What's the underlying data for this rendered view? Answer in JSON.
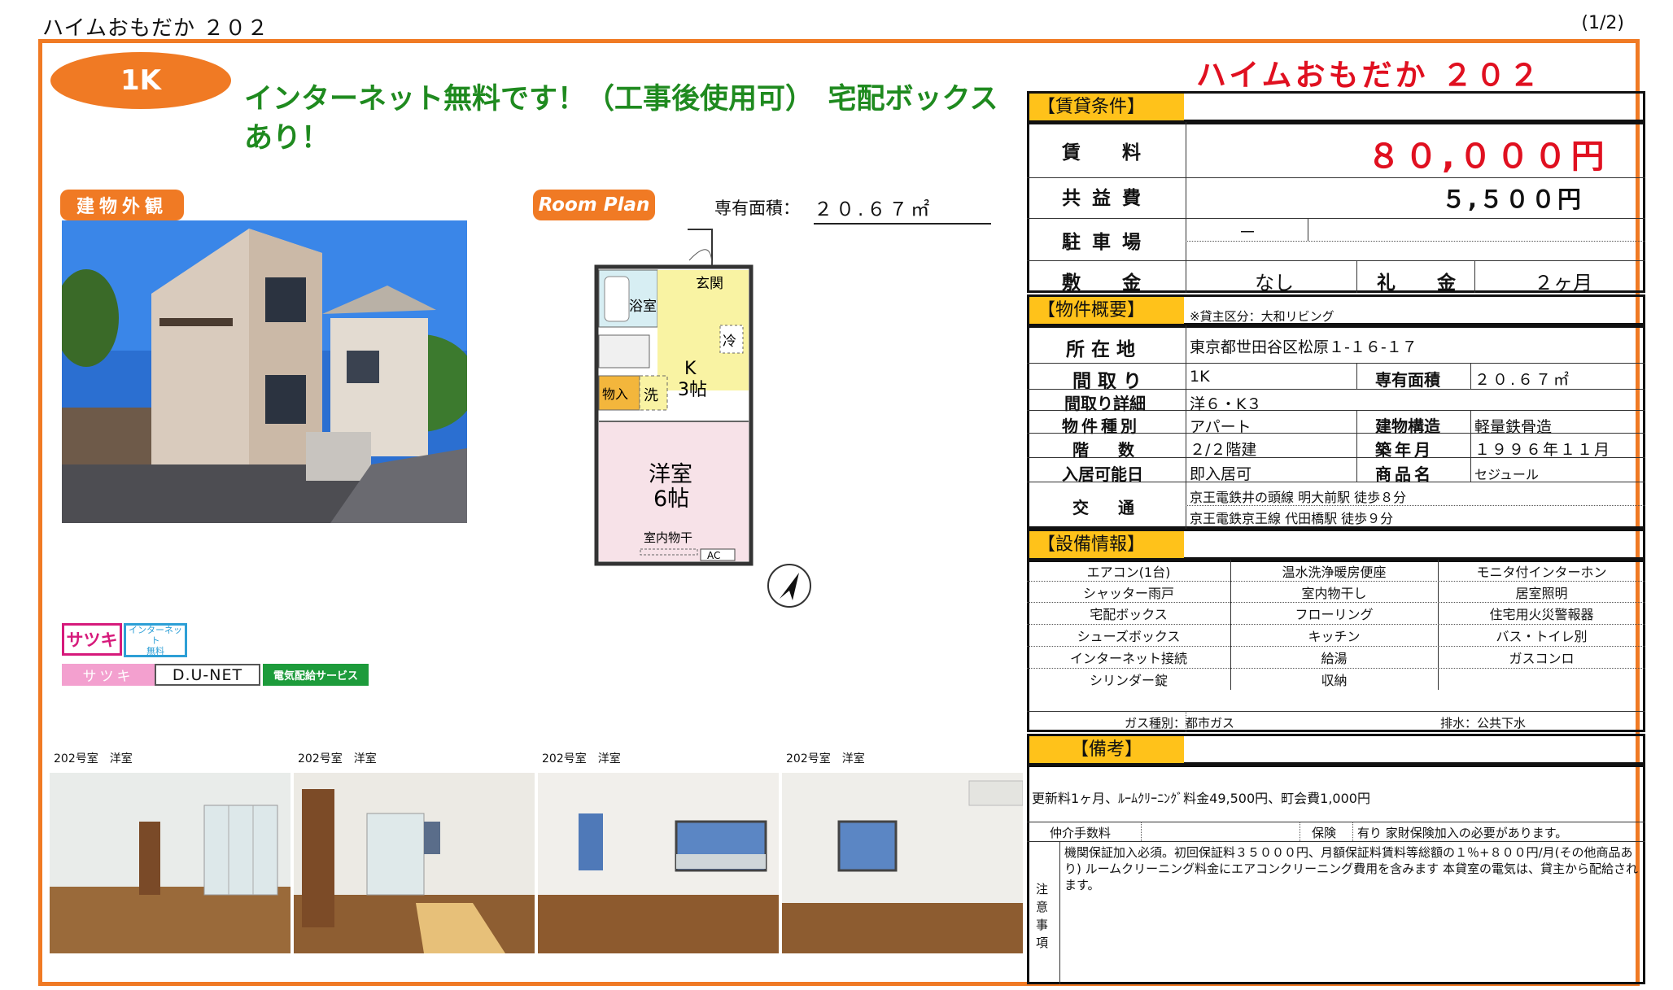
{
  "header": {
    "title": "ハイムおもだか ２０２",
    "page_indicator": "(1/2)"
  },
  "left": {
    "layout_badge": "1K",
    "catchphrase": "インターネット無料です！（工事後使用可）　宅配ボックスあり！",
    "exterior_tag": "建物外観",
    "plan_tag": "Room Plan",
    "area_label": "専有面積：",
    "area_value": "２０.６７㎡",
    "floor_plan": {
      "bath": "浴室",
      "entrance": "玄関",
      "kitchen": "K\n3帖",
      "kitchen_k": "K",
      "kitchen_size": "3帖",
      "storage": "物入",
      "washer": "洗",
      "fridge": "冷",
      "western": "洋室",
      "western_size": "6帖",
      "dry": "室内物干",
      "ac": "AC"
    },
    "logos": {
      "satsuki": "サツキ",
      "internet_free": "インターネット\n無料",
      "internet_free_1": "インターネット",
      "internet_free_2": "無料",
      "satsuki_band": "サツキ",
      "dunet": "D.U-NET",
      "power": "電気配給サービス"
    },
    "room_photos": [
      {
        "label": "202号室　洋室"
      },
      {
        "label": "202号室　洋室"
      },
      {
        "label": "202号室　洋室"
      },
      {
        "label": "202号室　洋室"
      }
    ]
  },
  "right": {
    "property_title": "ハイムおもだか ２０２",
    "rent_section": "【賃貸条件】",
    "rent_label": "賃　料",
    "rent_value": "８０,０００円",
    "common_label": "共益費",
    "common_value": "５,５００円",
    "parking_label": "駐車場",
    "parking_value": "－",
    "deposit_label": "敷　金",
    "deposit_value": "なし",
    "key_money_label": "礼　金",
    "key_money_value": "２ヶ月",
    "overview_section": "【物件概要】",
    "landlord_note": "※貸主区分：大和リビング",
    "address_label": "所在地",
    "address_value": "東京都世田谷区松原１-１６-１７",
    "layout_label": "間取り",
    "layout_value": "1K",
    "area_label": "専有面積",
    "area_value": "２０.６７㎡",
    "layout_detail_label": "間取り詳細",
    "layout_detail_value": "洋６・K３",
    "type_label": "物件種別",
    "type_value": "アパート",
    "structure_label": "建物構造",
    "structure_value": "軽量鉄骨造",
    "floors_label": "階　数",
    "floors_value": "２/２階建",
    "built_label": "築年月",
    "built_value": "１９９６年１１月",
    "move_in_label": "入居可能日",
    "move_in_value": "即入居可",
    "product_label": "商品名",
    "product_value": "セジュール",
    "transport_label": "交　通",
    "transport_1": "京王電鉄井の頭線 明大前駅 徒歩８分",
    "transport_2": "京王電鉄京王線 代田橋駅 徒歩９分",
    "equipment_section": "【設備情報】",
    "equipment": [
      [
        "エアコン(1台)",
        "温水洗浄暖房便座",
        "モニタ付インターホン"
      ],
      [
        "シャッター雨戸",
        "室内物干し",
        "居室照明"
      ],
      [
        "宅配ボックス",
        "フローリング",
        "住宅用火災警報器"
      ],
      [
        "シューズボックス",
        "キッチン",
        "バス・トイレ別"
      ],
      [
        "インターネット接続",
        "給湯",
        "ガスコンロ"
      ],
      [
        "シリンダー錠",
        "収納",
        ""
      ]
    ],
    "gas_type": "ガス種別：都市ガス",
    "drainage": "排水：公共下水",
    "remarks_section": "【備考】",
    "remarks_text": "更新料1ヶ月、ﾙｰﾑｸﾘｰﾆﾝｸﾞ料金49,500円、町会費1,000円",
    "broker_fee_label": "仲介手数料",
    "insurance_label": "保険",
    "insurance_value": "有り 家財保険加入の必要があります。",
    "notes_label": "注意事項",
    "notes_text": "機関保証加入必須。初回保証料３５０００円、月額保証料賃料等総額の１％+８００円/月(その他商品あり)  ルームクリーニング料金にエアコンクリーニング費用を含みます 本貸室の電気は、貸主から配給されます。"
  }
}
